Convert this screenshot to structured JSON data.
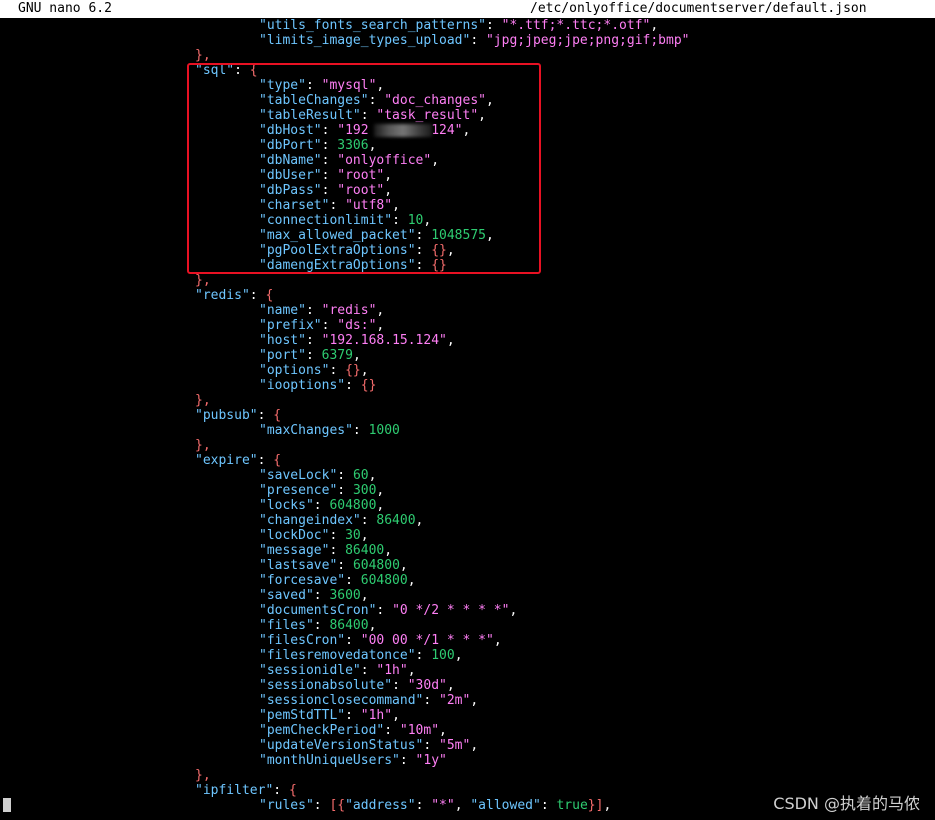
{
  "titlebar": {
    "app": "GNU nano 6.2",
    "file": "/etc/onlyoffice/documentserver/default.json"
  },
  "watermark": "CSDN @执着的马侬",
  "colors": {
    "key": "#6ec6ff",
    "string": "#ff7ff5",
    "number": "#2ecc71",
    "punctuation": "#f56c6c",
    "highlight_border": "#e81123"
  },
  "lines": [
    {
      "indent": 2,
      "key": "utils_fonts_search_patterns",
      "val": "\"*.ttf;*.ttc;*.otf\"",
      "type": "s",
      "end": ","
    },
    {
      "indent": 2,
      "key": "limits_image_types_upload",
      "val": "\"jpg;jpeg;jpe;png;gif;bmp\"",
      "type": "s",
      "end": ""
    },
    {
      "indent": 1,
      "punct": "},"
    },
    {
      "indent": 1,
      "key": "sql",
      "val": "{",
      "type": "p",
      "end": ""
    },
    {
      "indent": 2,
      "key": "type",
      "val": "\"mysql\"",
      "type": "s",
      "end": ","
    },
    {
      "indent": 2,
      "key": "tableChanges",
      "val": "\"doc_changes\"",
      "type": "s",
      "end": ","
    },
    {
      "indent": 2,
      "key": "tableResult",
      "val": "\"task_result\"",
      "type": "s",
      "end": ","
    },
    {
      "indent": 2,
      "key": "dbHost",
      "val": "\"192        124\"",
      "type": "s",
      "end": ","
    },
    {
      "indent": 2,
      "key": "dbPort",
      "val": "3306",
      "type": "n",
      "end": ","
    },
    {
      "indent": 2,
      "key": "dbName",
      "val": "\"onlyoffice\"",
      "type": "s",
      "end": ","
    },
    {
      "indent": 2,
      "key": "dbUser",
      "val": "\"root\"",
      "type": "s",
      "end": ","
    },
    {
      "indent": 2,
      "key": "dbPass",
      "val": "\"root\"",
      "type": "s",
      "end": ","
    },
    {
      "indent": 2,
      "key": "charset",
      "val": "\"utf8\"",
      "type": "s",
      "end": ","
    },
    {
      "indent": 2,
      "key": "connectionlimit",
      "val": "10",
      "type": "n",
      "end": ","
    },
    {
      "indent": 2,
      "key": "max_allowed_packet",
      "val": "1048575",
      "type": "n",
      "end": ","
    },
    {
      "indent": 2,
      "key": "pgPoolExtraOptions",
      "val": "{}",
      "type": "p",
      "end": ","
    },
    {
      "indent": 2,
      "key": "damengExtraOptions",
      "val": "{}",
      "type": "p",
      "end": ""
    },
    {
      "indent": 1,
      "punct": "},"
    },
    {
      "indent": 1,
      "key": "redis",
      "val": "{",
      "type": "p",
      "end": ""
    },
    {
      "indent": 2,
      "key": "name",
      "val": "\"redis\"",
      "type": "s",
      "end": ","
    },
    {
      "indent": 2,
      "key": "prefix",
      "val": "\"ds:\"",
      "type": "s",
      "end": ","
    },
    {
      "indent": 2,
      "key": "host",
      "val": "\"192.168.15.124\"",
      "type": "s",
      "end": ","
    },
    {
      "indent": 2,
      "key": "port",
      "val": "6379",
      "type": "n",
      "end": ","
    },
    {
      "indent": 2,
      "key": "options",
      "val": "{}",
      "type": "p",
      "end": ","
    },
    {
      "indent": 2,
      "key": "iooptions",
      "val": "{}",
      "type": "p",
      "end": ""
    },
    {
      "indent": 1,
      "punct": "},"
    },
    {
      "indent": 1,
      "key": "pubsub",
      "val": "{",
      "type": "p",
      "end": ""
    },
    {
      "indent": 2,
      "key": "maxChanges",
      "val": "1000",
      "type": "n",
      "end": ""
    },
    {
      "indent": 1,
      "punct": "},"
    },
    {
      "indent": 1,
      "key": "expire",
      "val": "{",
      "type": "p",
      "end": ""
    },
    {
      "indent": 2,
      "key": "saveLock",
      "val": "60",
      "type": "n",
      "end": ","
    },
    {
      "indent": 2,
      "key": "presence",
      "val": "300",
      "type": "n",
      "end": ","
    },
    {
      "indent": 2,
      "key": "locks",
      "val": "604800",
      "type": "n",
      "end": ","
    },
    {
      "indent": 2,
      "key": "changeindex",
      "val": "86400",
      "type": "n",
      "end": ","
    },
    {
      "indent": 2,
      "key": "lockDoc",
      "val": "30",
      "type": "n",
      "end": ","
    },
    {
      "indent": 2,
      "key": "message",
      "val": "86400",
      "type": "n",
      "end": ","
    },
    {
      "indent": 2,
      "key": "lastsave",
      "val": "604800",
      "type": "n",
      "end": ","
    },
    {
      "indent": 2,
      "key": "forcesave",
      "val": "604800",
      "type": "n",
      "end": ","
    },
    {
      "indent": 2,
      "key": "saved",
      "val": "3600",
      "type": "n",
      "end": ","
    },
    {
      "indent": 2,
      "key": "documentsCron",
      "val": "\"0 */2 * * * *\"",
      "type": "s",
      "end": ","
    },
    {
      "indent": 2,
      "key": "files",
      "val": "86400",
      "type": "n",
      "end": ","
    },
    {
      "indent": 2,
      "key": "filesCron",
      "val": "\"00 00 */1 * * *\"",
      "type": "s",
      "end": ","
    },
    {
      "indent": 2,
      "key": "filesremovedatonce",
      "val": "100",
      "type": "n",
      "end": ","
    },
    {
      "indent": 2,
      "key": "sessionidle",
      "val": "\"1h\"",
      "type": "s",
      "end": ","
    },
    {
      "indent": 2,
      "key": "sessionabsolute",
      "val": "\"30d\"",
      "type": "s",
      "end": ","
    },
    {
      "indent": 2,
      "key": "sessionclosecommand",
      "val": "\"2m\"",
      "type": "s",
      "end": ","
    },
    {
      "indent": 2,
      "key": "pemStdTTL",
      "val": "\"1h\"",
      "type": "s",
      "end": ","
    },
    {
      "indent": 2,
      "key": "pemCheckPeriod",
      "val": "\"10m\"",
      "type": "s",
      "end": ","
    },
    {
      "indent": 2,
      "key": "updateVersionStatus",
      "val": "\"5m\"",
      "type": "s",
      "end": ","
    },
    {
      "indent": 2,
      "key": "monthUniqueUsers",
      "val": "\"1y\"",
      "type": "s",
      "end": ""
    },
    {
      "indent": 1,
      "punct": "},"
    },
    {
      "indent": 1,
      "key": "ipfilter",
      "val": "{",
      "type": "p",
      "end": ""
    },
    {
      "indent": 2,
      "key": "rules",
      "val": "[{\"address\": \"*\", \"allowed\": true}]",
      "type": "rules",
      "end": ","
    }
  ]
}
